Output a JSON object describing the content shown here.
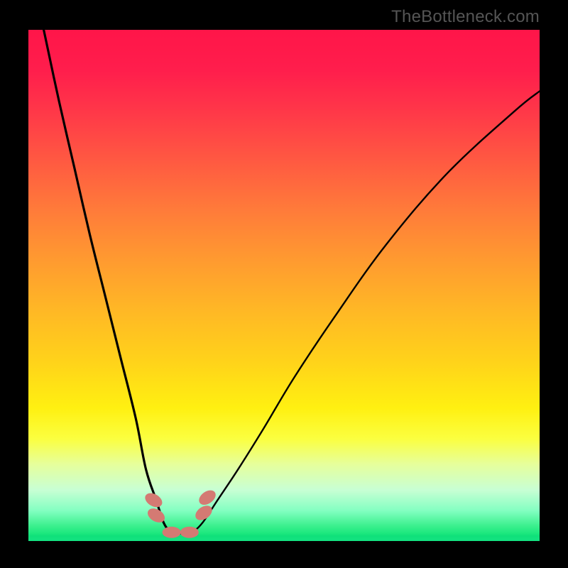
{
  "watermark": "TheBottleneck.com",
  "chart_data": {
    "type": "line",
    "title": "",
    "xlabel": "",
    "ylabel": "",
    "xlim": [
      0,
      100
    ],
    "ylim": [
      0,
      100
    ],
    "series": [
      {
        "name": "curve",
        "x": [
          3,
          6,
          9,
          12,
          15,
          18,
          21,
          23,
          25,
          26.5,
          28,
          30,
          32,
          34,
          37,
          41,
          46,
          52,
          60,
          70,
          82,
          95,
          100
        ],
        "values": [
          100,
          86,
          73,
          60,
          48,
          36,
          24,
          14,
          8,
          3.5,
          1.8,
          1.5,
          1.8,
          3.5,
          8,
          14,
          22,
          32,
          44,
          58,
          72,
          84,
          88
        ]
      }
    ],
    "markers": [
      {
        "name": "cluster-left-upper",
        "x": 24.5,
        "y": 8
      },
      {
        "name": "cluster-left-lower",
        "x": 25.0,
        "y": 5
      },
      {
        "name": "cluster-min-left",
        "x": 28.0,
        "y": 1.7
      },
      {
        "name": "cluster-min-right",
        "x": 31.5,
        "y": 1.7
      },
      {
        "name": "cluster-right-lower",
        "x": 34.3,
        "y": 5.5
      },
      {
        "name": "cluster-right-upper",
        "x": 35.0,
        "y": 8.5
      }
    ],
    "gradient_stops": [
      {
        "pos": 0,
        "color": "#ff1549"
      },
      {
        "pos": 25,
        "color": "#ff5742"
      },
      {
        "pos": 50,
        "color": "#ffb825"
      },
      {
        "pos": 75,
        "color": "#fff011"
      },
      {
        "pos": 100,
        "color": "#14e381"
      }
    ]
  }
}
